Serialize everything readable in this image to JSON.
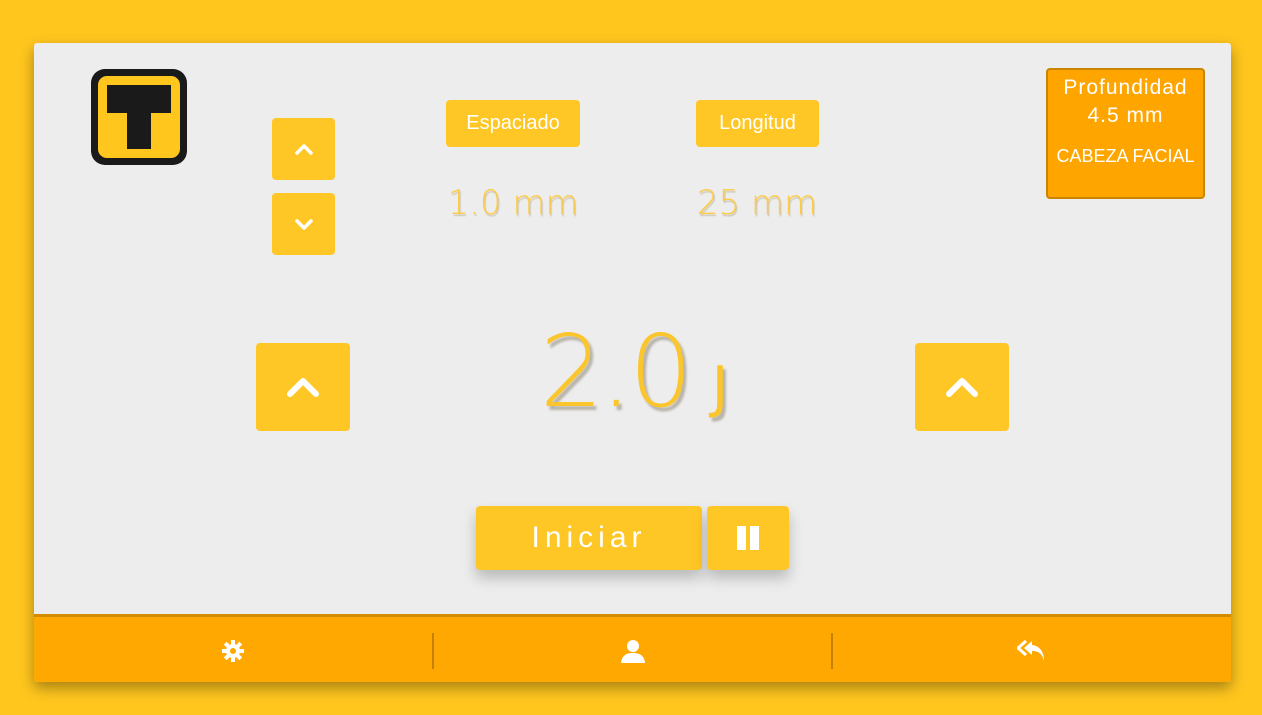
{
  "logo": {
    "icon": "t-logo-icon",
    "colors": {
      "outer": "#1A1A1A",
      "inner": "#FFC61E"
    }
  },
  "controls": {
    "small_up_icon": "chevron-up-icon",
    "small_down_icon": "chevron-down-icon",
    "big_left_icon": "chevron-up-icon",
    "big_right_icon": "chevron-up-icon"
  },
  "spacing": {
    "label": "Espaciado",
    "value": "1.0 mm"
  },
  "length": {
    "label": "Longitud",
    "value": "25 mm"
  },
  "energy": {
    "value": "2.0",
    "unit": "J"
  },
  "depth_box": {
    "title": "Profundidad",
    "value": "4.5 mm",
    "head": "CABEZA FACIAL"
  },
  "actions": {
    "start_label": "Iniciar",
    "pause_icon": "pause-icon"
  },
  "footer": {
    "items": [
      "gear-icon",
      "user-icon",
      "reply-all-icon"
    ]
  },
  "colors": {
    "background": "#FFC61E",
    "panel": "#EDEDED",
    "accent": "#FFC726",
    "footer": "#FFA802",
    "depth_box": "#FFA500"
  }
}
